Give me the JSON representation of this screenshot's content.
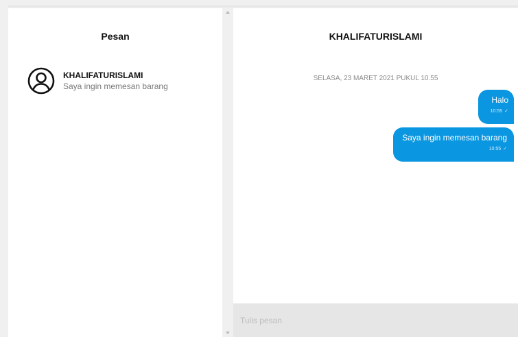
{
  "sidebar": {
    "title": "Pesan",
    "contacts": [
      {
        "name": "KHALIFATURISLAMI",
        "preview": "Saya ingin memesan barang",
        "icon": "user-circle-icon"
      }
    ]
  },
  "chat": {
    "title": "KHALIFATURISLAMI",
    "date_separator": "SELASA, 23 MARET 2021 PUKUL 10.55",
    "messages": [
      {
        "text": "Halo",
        "time": "10:55",
        "status": "✓"
      },
      {
        "text": "Saya ingin memesan barang",
        "time": "10:55",
        "status": "✓"
      }
    ],
    "composer": {
      "placeholder": "Tulis pesan",
      "value": ""
    }
  },
  "colors": {
    "bubble": "#0a96e0",
    "background": "#f0f0f0",
    "composer": "#e6e6e6"
  }
}
